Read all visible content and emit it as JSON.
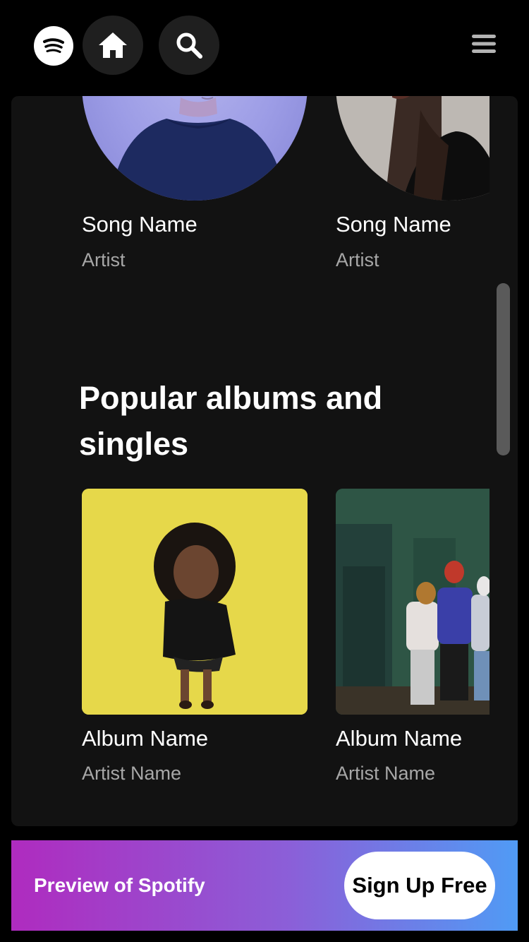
{
  "header": {
    "logo_icon": "spotify-logo-icon",
    "home_icon": "home-icon",
    "search_icon": "search-icon",
    "menu_icon": "hamburger-menu-icon"
  },
  "songs": [
    {
      "title": "Song Name",
      "artist": "Artist"
    },
    {
      "title": "Song Name",
      "artist": "Artist"
    }
  ],
  "albums_section": {
    "title": "Popular albums and singles",
    "items": [
      {
        "title": "Album Name",
        "artist": "Artist Name"
      },
      {
        "title": "Album Name",
        "artist": "Artist Name"
      }
    ]
  },
  "banner": {
    "text": "Preview of Spotify",
    "button_label": "Sign Up Free"
  },
  "colors": {
    "background": "#000000",
    "panel": "#121212",
    "secondary_text": "#a7a7a7",
    "banner_gradient_start": "#af2bbf",
    "banner_gradient_end": "#509bf5"
  }
}
